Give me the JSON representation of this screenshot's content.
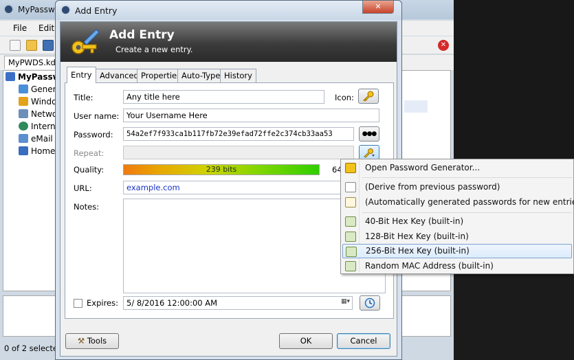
{
  "main_window": {
    "title": "MyPassw",
    "menu": [
      "File",
      "Edit"
    ],
    "doc_tab": "MyPWDS.kdb",
    "tree_root": "MyPassw",
    "tree_items": [
      "Gener",
      "Windo",
      "Netwo",
      "Intern",
      "eMail",
      "Home"
    ],
    "status": "0 of 2 selected"
  },
  "dialog": {
    "title": "Add Entry",
    "close_glyph": "✕",
    "minimize_glyph": "–",
    "maximize_glyph": "□",
    "banner_title": "Add Entry",
    "banner_subtitle": "Create a new entry.",
    "tabs": [
      "Entry",
      "Advanced",
      "Properties",
      "Auto-Type",
      "History"
    ],
    "active_tab": "Entry",
    "fields": {
      "title_label": "Title:",
      "title_value": "Any title here",
      "icon_label": "Icon:",
      "username_label": "User name:",
      "username_value": "Your Username Here",
      "password_label": "Password:",
      "password_value": "54a2ef7f933ca1b117fb72e39efad72ffe2c374cb33aa53",
      "reveal_button": "●●●",
      "repeat_label": "Repeat:",
      "quality_label": "Quality:",
      "quality_text": "239 bits",
      "quality_fraction": 0.93,
      "quality_count": "64",
      "url_label": "URL:",
      "url_value": "example.com",
      "notes_label": "Notes:",
      "expires_label": "Expires:",
      "expires_value": "5/  8/2016 12:00:00 AM"
    },
    "buttons": {
      "tools": "Tools",
      "ok": "OK",
      "cancel": "Cancel"
    }
  },
  "context_menu": {
    "items": [
      "Open Password Generator...",
      "(Derive from previous password)",
      "(Automatically generated passwords for new entries)",
      "40-Bit Hex Key (built-in)",
      "128-Bit Hex Key (built-in)",
      "256-Bit Hex Key (built-in)",
      "Random MAC Address (built-in)"
    ],
    "highlighted": "256-Bit Hex Key (built-in)"
  },
  "colors": {
    "accent_highlight": "#dcebfc",
    "link": "#1631c7",
    "close_red": "#c8432a"
  }
}
